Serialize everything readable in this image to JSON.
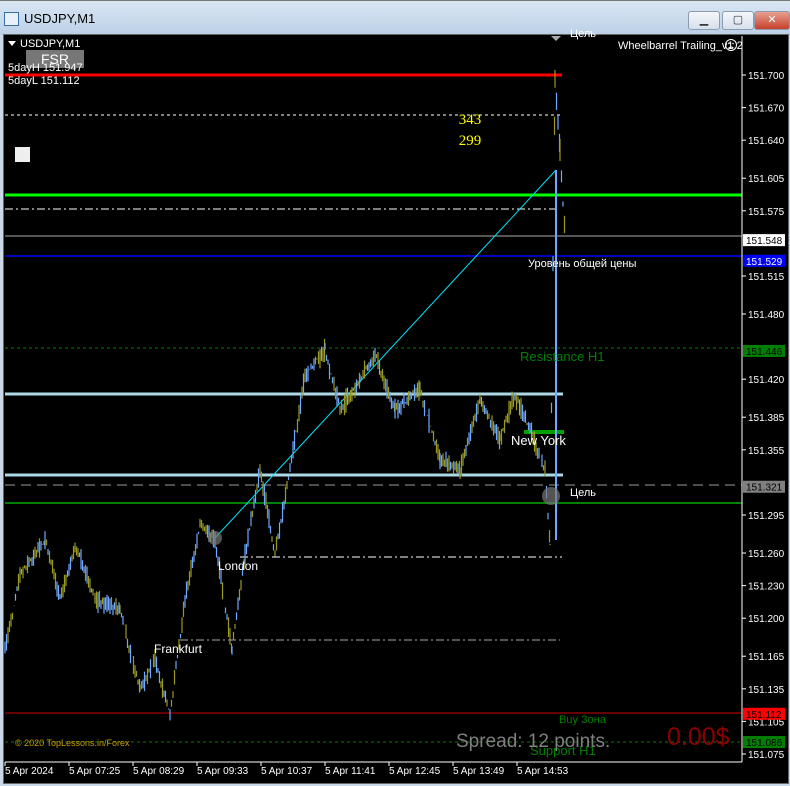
{
  "window": {
    "title": "USDJPY,M1",
    "buttons": [
      "minimize",
      "maximize",
      "close"
    ]
  },
  "chart": {
    "symbol_label": "USDJPY,M1",
    "fsr_button": "FSR",
    "five_day_high": "5dayH 151.947",
    "five_day_low": "5dayL 151.112",
    "ea_name": "Wheelbarrel Trailing_v1.2",
    "ea_status_icon": "sad-face-icon",
    "counter_top": "343",
    "counter_bottom": "299",
    "top_target_label": "Цель",
    "common_price_label": "Уровень общей цены",
    "resistance_label": "Resistance H1",
    "new_york_label": "New York",
    "target_label": "Цель",
    "london_label": "London",
    "frankfurt_label": "Frankfurt",
    "buy_zone_label": "Buy Зона",
    "support_label": "Support H1",
    "spread_text": "Spread: 12 points.",
    "profit_text": "0.00$",
    "copyright": "© 2020 TopLessons.in/Forex",
    "price_ticks": [
      "151.700",
      "151.670",
      "151.640",
      "151.605",
      "151.575",
      "151.515",
      "151.480",
      "151.420",
      "151.385",
      "151.355",
      "151.295",
      "151.260",
      "151.230",
      "151.200",
      "151.165",
      "151.135",
      "151.105",
      "151.075"
    ],
    "price_boxes": [
      {
        "value": "151.548",
        "bg": "#ffffff",
        "fg": "#000000"
      },
      {
        "value": "151.529",
        "bg": "#0000ff",
        "fg": "#ffffff"
      },
      {
        "value": "151.446",
        "bg": "#008000",
        "fg": "#000000"
      },
      {
        "value": "151.321",
        "bg": "#808080",
        "fg": "#000000"
      },
      {
        "value": "151.112",
        "bg": "#ff0000",
        "fg": "#000000"
      },
      {
        "value": "151.086",
        "bg": "#008000",
        "fg": "#000000"
      }
    ],
    "time_ticks": [
      "5 Apr 2024",
      "5 Apr 07:25",
      "5 Apr 08:29",
      "5 Apr 09:33",
      "5 Apr 10:37",
      "5 Apr 11:41",
      "5 Apr 12:45",
      "5 Apr 13:49",
      "5 Apr 14:53"
    ],
    "colors": {
      "resistance": "#ff0000",
      "green_level": "#00ff00",
      "blue_level": "#0000ff",
      "candles_up": "#6fa8ff",
      "candles_down": "#9a9a20",
      "counter": "#ffff00",
      "profit": "#8b0000"
    }
  }
}
